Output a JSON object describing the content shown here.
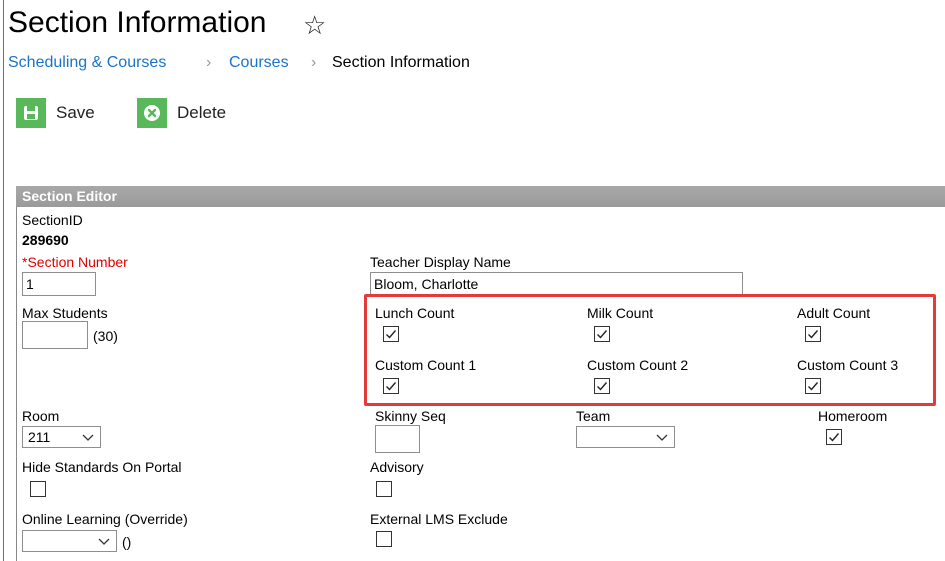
{
  "page": {
    "title": "Section Information",
    "star_icon": "star-outline-icon"
  },
  "breadcrumb": [
    {
      "label": "Scheduling & Courses"
    },
    {
      "label": "Courses"
    },
    {
      "label": "Section Information"
    }
  ],
  "toolbar": {
    "save_label": "Save",
    "save_icon": "floppy-disk-icon",
    "delete_label": "Delete",
    "delete_icon": "x-circle-icon",
    "icon_color": "#59b85a"
  },
  "editor": {
    "header": "Section Editor",
    "section_id_label": "SectionID",
    "section_id_value": "289690",
    "section_number_label": "*Section Number",
    "section_number_value": "1",
    "max_students_label": "Max Students",
    "max_students_value": "",
    "max_students_hint": "(30)",
    "teacher_display_name_label": "Teacher Display Name",
    "teacher_display_name_value": "Bloom, Charlotte",
    "lunch_count_label": "Lunch Count",
    "lunch_count_checked": true,
    "milk_count_label": "Milk Count",
    "milk_count_checked": true,
    "adult_count_label": "Adult Count",
    "adult_count_checked": true,
    "custom1_label": "Custom Count 1",
    "custom1_checked": true,
    "custom2_label": "Custom Count 2",
    "custom2_checked": true,
    "custom3_label": "Custom Count 3",
    "custom3_checked": true,
    "room_label": "Room",
    "room_value": "211",
    "skinny_seq_label": "Skinny Seq",
    "skinny_seq_value": "",
    "team_label": "Team",
    "team_value": "",
    "homeroom_label": "Homeroom",
    "homeroom_checked": true,
    "hide_standards_label": "Hide Standards On Portal",
    "hide_standards_checked": false,
    "advisory_label": "Advisory",
    "advisory_checked": false,
    "online_learning_label": "Online Learning (Override)",
    "online_learning_value": "",
    "online_learning_hint": "()",
    "external_lms_label": "External LMS Exclude",
    "external_lms_checked": false
  },
  "colors": {
    "link": "#1a73c8",
    "required": "#e00000",
    "header_bg": "#a0a0a0",
    "highlight": "#e53a3a"
  }
}
